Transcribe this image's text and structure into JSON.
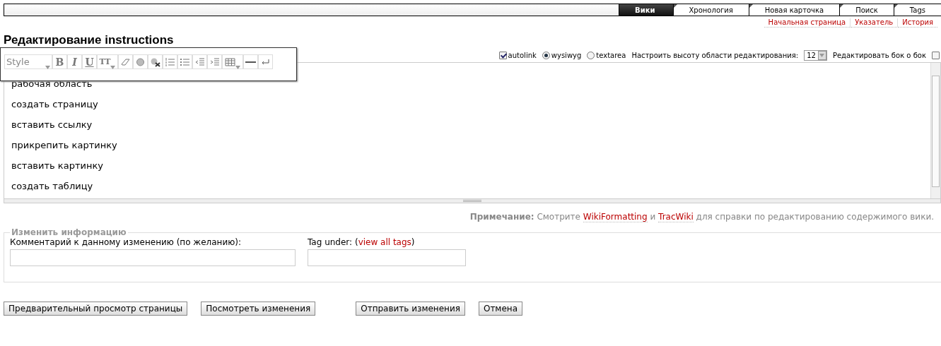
{
  "nav_tabs": [
    {
      "label": "Вики",
      "selected": true
    },
    {
      "label": "Хронология",
      "selected": false
    },
    {
      "label": "Новая карточка",
      "selected": false
    },
    {
      "label": "Поиск",
      "selected": false
    },
    {
      "label": "Tags",
      "selected": false
    }
  ],
  "context_links": [
    "Начальная страница",
    "Указатель",
    "История"
  ],
  "title": "Редактирование instructions",
  "toolbar": {
    "style": "Style",
    "bold": "B",
    "italic": "I",
    "underline": "U",
    "monospace": "TT"
  },
  "options": {
    "autolink": {
      "label": "autolink",
      "checked": true
    },
    "modes": [
      {
        "label": "wysiwyg",
        "selected": true
      },
      {
        "label": "textarea",
        "selected": false
      }
    ],
    "height_label": "Настроить высоту области редактирования:",
    "height_value": "12",
    "side_by_side": {
      "label": "Редактировать бок о бок",
      "checked": false
    }
  },
  "editor_lines": [
    "рабочая область",
    "создать страницу",
    "вставить ссылку",
    "прикрепить картинку",
    "вставить картинку",
    "создать таблицу"
  ],
  "note": {
    "label": "Примечание:",
    "before": "Смотрите",
    "link1": "WikiFormatting",
    "middle": "и",
    "link2": "TracWiki",
    "after": "для справки по редактированию содержимого вики."
  },
  "change_info": {
    "legend": "Изменить информацию",
    "comment_label": "Комментарий к данному изменению (по желанию):",
    "tag_label": "Tag under:",
    "tag_link": "view all tags",
    "tag_link_open": "(",
    "tag_link_close": ")"
  },
  "buttons": [
    "Предварительный просмотр страницы",
    "Посмотреть изменения",
    "Отправить изменения",
    "Отмена"
  ]
}
